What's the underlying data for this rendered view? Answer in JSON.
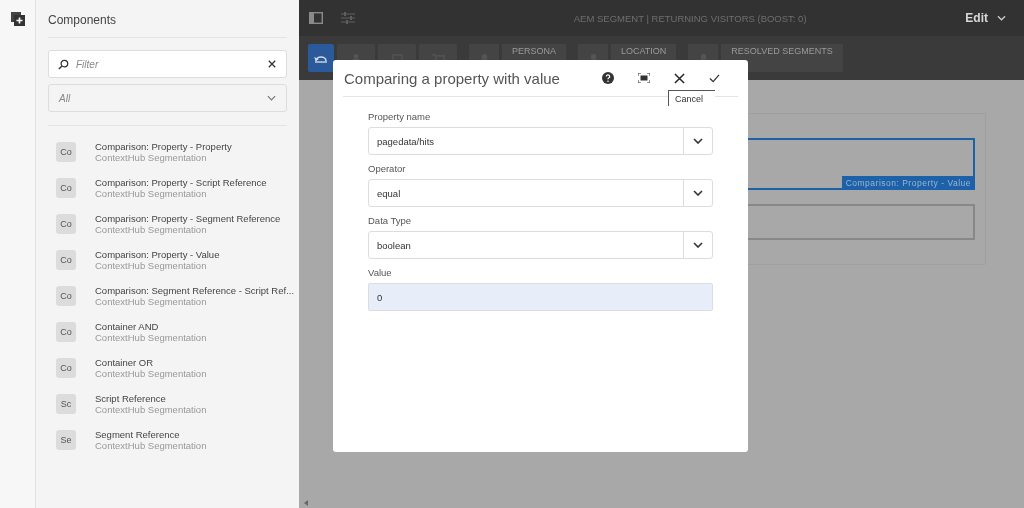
{
  "sidebar": {
    "title": "Components",
    "filter": {
      "placeholder": "Filter"
    },
    "group_select": {
      "value": "All"
    },
    "items": [
      {
        "badge": "Co",
        "title": "Comparison: Property - Property",
        "subtitle": "ContextHub Segmentation"
      },
      {
        "badge": "Co",
        "title": "Comparison: Property - Script Reference",
        "subtitle": "ContextHub Segmentation"
      },
      {
        "badge": "Co",
        "title": "Comparison: Property - Segment Reference",
        "subtitle": "ContextHub Segmentation"
      },
      {
        "badge": "Co",
        "title": "Comparison: Property - Value",
        "subtitle": "ContextHub Segmentation"
      },
      {
        "badge": "Co",
        "title": "Comparison: Segment Reference - Script Ref...",
        "subtitle": "ContextHub Segmentation"
      },
      {
        "badge": "Co",
        "title": "Container AND",
        "subtitle": "ContextHub Segmentation"
      },
      {
        "badge": "Co",
        "title": "Container OR",
        "subtitle": "ContextHub Segmentation"
      },
      {
        "badge": "Sc",
        "title": "Script Reference",
        "subtitle": "ContextHub Segmentation"
      },
      {
        "badge": "Se",
        "title": "Segment Reference",
        "subtitle": "ContextHub Segmentation"
      }
    ]
  },
  "header": {
    "title": "AEM SEGMENT | RETURNING VISITORS (BOOST: 0)",
    "mode": "Edit"
  },
  "toolbar": {
    "buttons": [
      {
        "selected": true
      },
      {
        "selected": false
      },
      {
        "selected": false
      },
      {
        "selected": false
      }
    ],
    "context_groups": [
      {
        "label": "PERSONA"
      },
      {
        "label": "LOCATION"
      },
      {
        "label": "RESOLVED SEGMENTS"
      }
    ]
  },
  "canvas": {
    "selected_component": {
      "label": "Comparison: Property - Value"
    }
  },
  "dialog": {
    "title": "Comparing a property with value",
    "tooltip": "Cancel",
    "fields": [
      {
        "kind": "select",
        "label": "Property name",
        "value": "pagedata/hits"
      },
      {
        "kind": "select",
        "label": "Operator",
        "value": "equal"
      },
      {
        "kind": "select",
        "label": "Data Type",
        "value": "boolean"
      },
      {
        "kind": "text",
        "label": "Value",
        "value": "0"
      }
    ]
  }
}
